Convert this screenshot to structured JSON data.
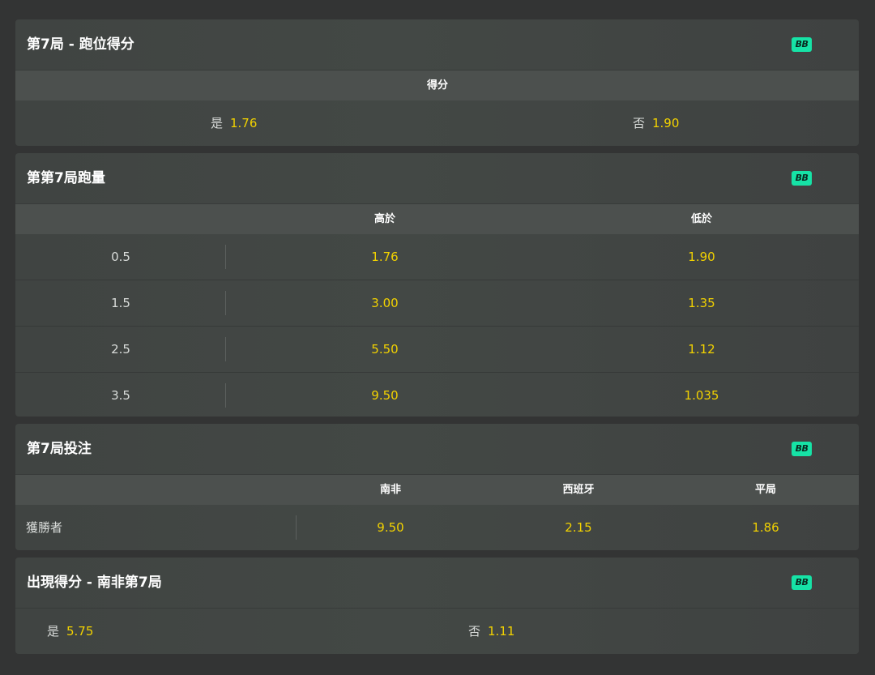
{
  "cards": [
    {
      "title": "第7局 - 跑位得分",
      "badge": "BB",
      "header": "得分",
      "options": [
        {
          "label": "是",
          "odds": "1.76"
        },
        {
          "label": "否",
          "odds": "1.90"
        }
      ]
    },
    {
      "title": "第第7局跑量",
      "badge": "BB",
      "columns": [
        "高於",
        "低於"
      ],
      "rows": [
        {
          "line": "0.5",
          "over": "1.76",
          "under": "1.90"
        },
        {
          "line": "1.5",
          "over": "3.00",
          "under": "1.35"
        },
        {
          "line": "2.5",
          "over": "5.50",
          "under": "1.12"
        },
        {
          "line": "3.5",
          "over": "9.50",
          "under": "1.035"
        }
      ]
    },
    {
      "title": "第7局投注",
      "badge": "BB",
      "columns": [
        "南非",
        "西班牙",
        "平局"
      ],
      "row": {
        "label": "獲勝者",
        "odds": [
          "9.50",
          "2.15",
          "1.86"
        ]
      }
    },
    {
      "title": "出現得分 - 南非第7局",
      "badge": "BB",
      "options": [
        {
          "label": "是",
          "odds": "5.75"
        },
        {
          "label": "否",
          "odds": "1.11"
        }
      ]
    }
  ],
  "colors": {
    "background": "#333434",
    "card": "#424644",
    "header_band": "#4c504e",
    "odds": "#f2d200",
    "badge": "#16e3a6"
  }
}
